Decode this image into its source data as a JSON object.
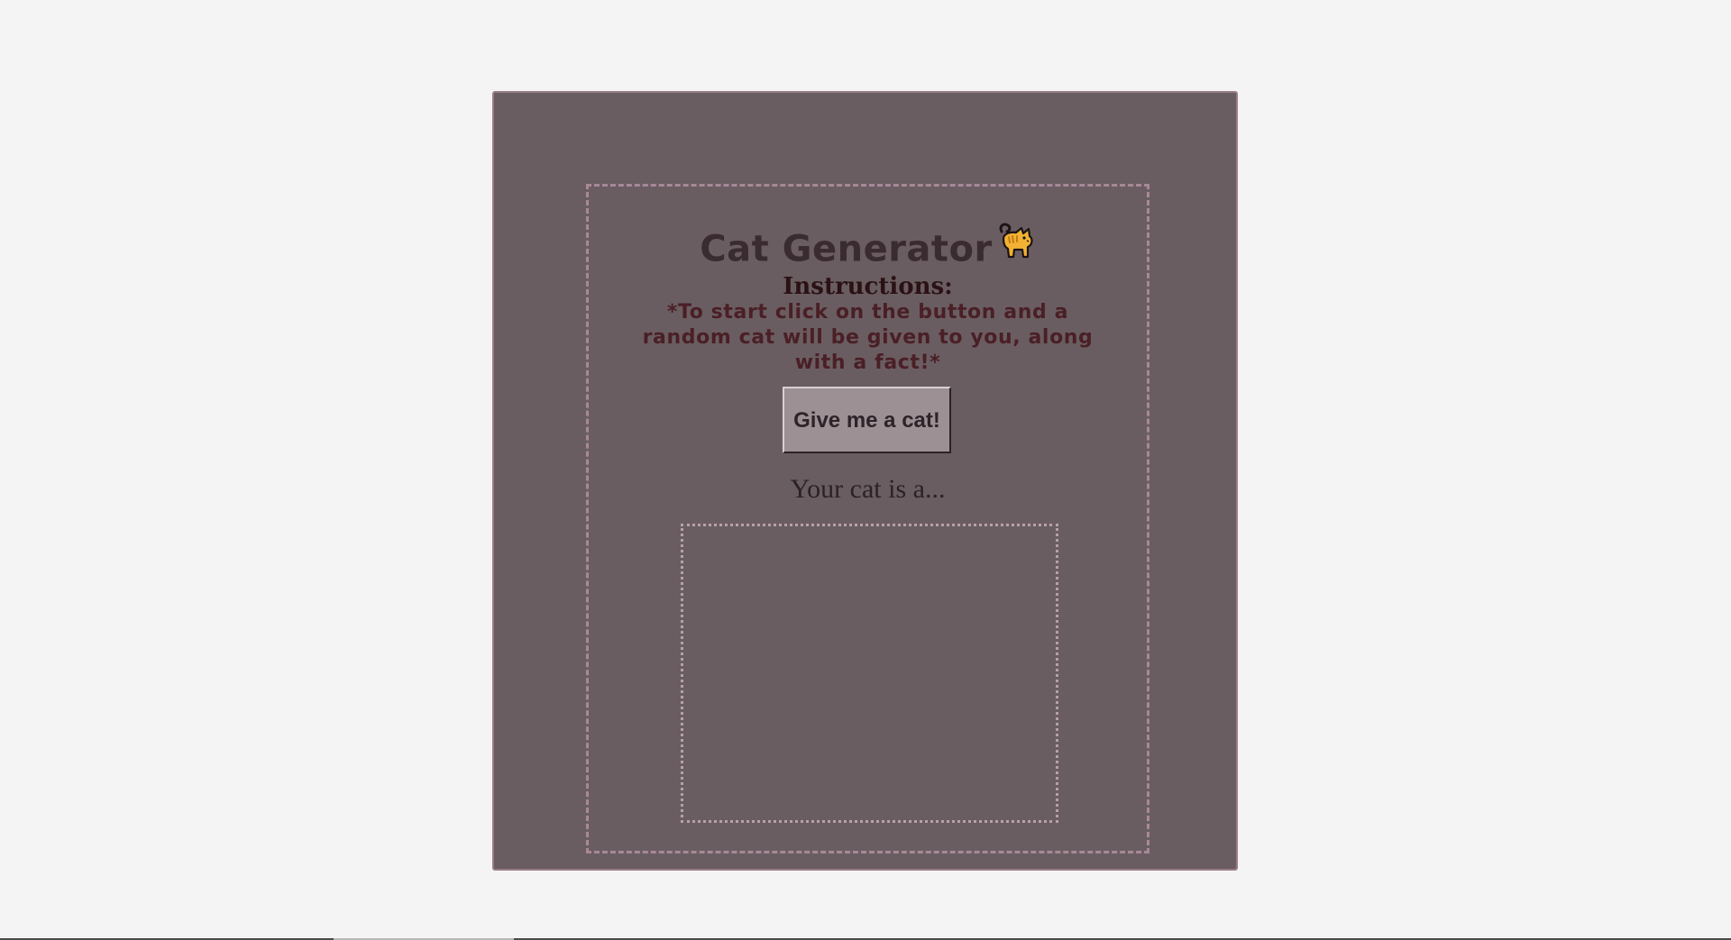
{
  "app": {
    "title": "Cat Generator",
    "title_icon": "cat-emoji-icon"
  },
  "instructions": {
    "heading": "Instructions:",
    "text": "*To start click on the button and a random cat will be given to you, along with a fact!*"
  },
  "controls": {
    "generate_label": "Give me a cat!"
  },
  "result": {
    "label": "Your cat is a..."
  },
  "colors": {
    "page_bg": "#f4f4f4",
    "card_bg": "#6a5d62",
    "card_border": "#9a7c89",
    "dashed_border": "#a88896",
    "button_bg": "#9c9095",
    "cat_body": "#f2b233"
  }
}
